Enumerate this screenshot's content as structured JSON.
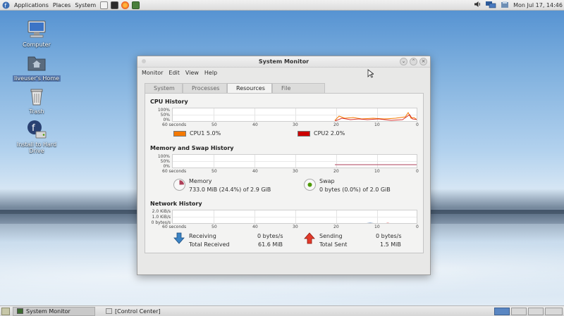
{
  "top_panel": {
    "menus": [
      "Applications",
      "Places",
      "System"
    ],
    "clock": "Mon Jul 17, 14:46"
  },
  "desktop": {
    "icons": [
      {
        "label": "Computer",
        "icon": "computer-icon"
      },
      {
        "label": "liveuser's Home",
        "icon": "home-folder-icon"
      },
      {
        "label": "Trash",
        "icon": "trash-icon"
      },
      {
        "label": "Install to Hard Drive",
        "icon": "installer-icon"
      }
    ]
  },
  "window": {
    "title": "System Monitor",
    "menu": [
      "Monitor",
      "Edit",
      "View",
      "Help"
    ],
    "tabs": [
      "System",
      "Processes",
      "Resources",
      "File Systems"
    ],
    "active_tab": "Resources",
    "cpu": {
      "title": "CPU History",
      "y_ticks": [
        "100%",
        "50%",
        "0%"
      ],
      "x_ticks": [
        "60 seconds",
        "50",
        "40",
        "30",
        "20",
        "10",
        "0"
      ],
      "cpu1": "CPU1 5.0%",
      "cpu2": "CPU2 2.0%",
      "cpu1_color": "#f57900",
      "cpu2_color": "#cc0000"
    },
    "memory": {
      "title": "Memory and Swap History",
      "y_ticks": [
        "100%",
        "50%",
        "0%"
      ],
      "x_ticks": [
        "60 seconds",
        "50",
        "40",
        "30",
        "20",
        "10",
        "0"
      ],
      "memory_label": "Memory",
      "memory_value": "733.0 MiB (24.4%) of 2.9 GiB",
      "memory_fraction": 0.244,
      "swap_label": "Swap",
      "swap_value": "0 bytes (0.0%) of 2.0 GiB",
      "memory_color": "#ad3f58",
      "swap_color": "#4e9a06"
    },
    "network": {
      "title": "Network History",
      "y_ticks": [
        "2.0 KiB/s",
        "1.0 KiB/s",
        "0 bytes/s"
      ],
      "x_ticks": [
        "60 seconds",
        "50",
        "40",
        "30",
        "20",
        "10",
        "0"
      ],
      "receiving_label": "Receiving",
      "receiving_rate": "0 bytes/s",
      "total_received_label": "Total Received",
      "total_received": "61.6 MiB",
      "sending_label": "Sending",
      "sending_rate": "0 bytes/s",
      "total_sent_label": "Total Sent",
      "total_sent": "1.5 MiB",
      "receive_color": "#3465a4",
      "send_color": "#cc0000"
    }
  },
  "taskbar": {
    "tasks": [
      "System Monitor",
      "[Control Center]"
    ]
  }
}
